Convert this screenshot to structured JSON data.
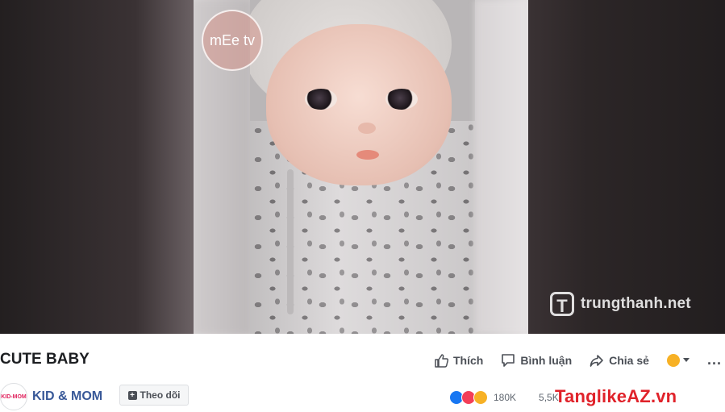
{
  "video": {
    "channel_logo_text": "mEe tv",
    "watermark_text": "trungthanh.net",
    "watermark_icon": "T"
  },
  "post": {
    "title": "CUTE BABY",
    "actions": {
      "like_label": "Thích",
      "comment_label": "Bình luận",
      "share_label": "Chia sẻ",
      "more_icon": "..."
    },
    "page": {
      "avatar_text": "KID-MOM",
      "name": "KID & MOM",
      "follow_label": "Theo dõi"
    },
    "stats": {
      "reactions_count": "180K",
      "comments_count": "5,5K"
    },
    "overlay_watermark": "TanglikeAZ.vn"
  },
  "colors": {
    "link": "#385898",
    "text_secondary": "#606770",
    "watermark_red": "#e0222a"
  }
}
